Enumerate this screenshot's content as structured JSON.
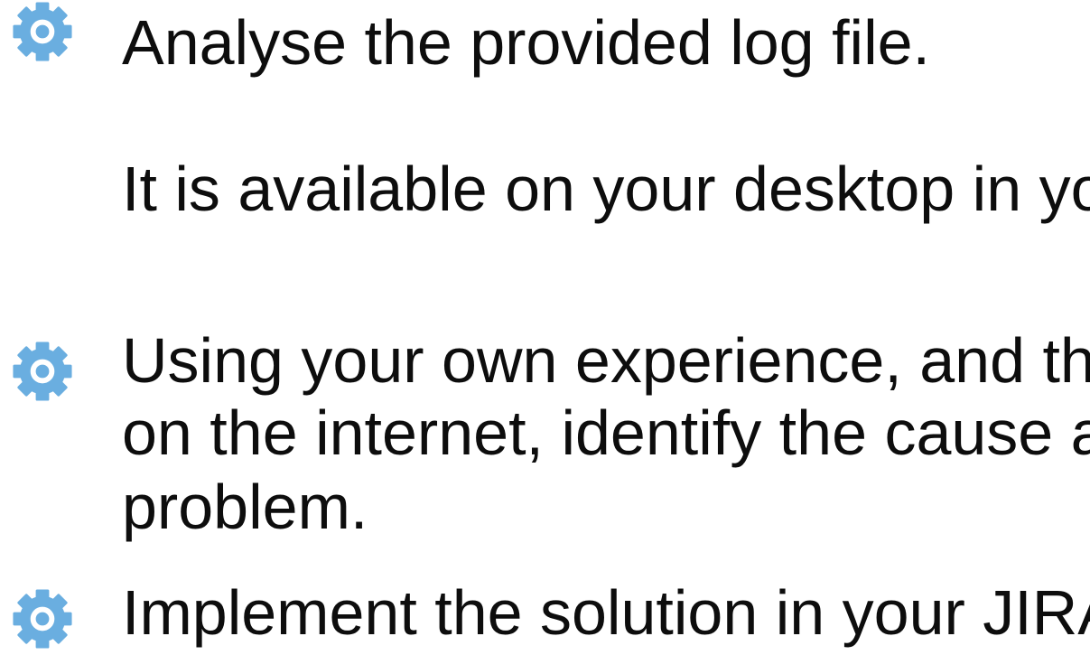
{
  "slide": {
    "bullets": [
      {
        "icon": "gear-icon",
        "lines": [
          "Analyse the provided log file."
        ]
      },
      {
        "icon": "none",
        "lines": [
          "It is available on your desktop in you"
        ]
      },
      {
        "icon": "gear-icon",
        "lines": [
          "Using your own experience, and the",
          "on the internet, identify the cause an",
          "problem."
        ]
      },
      {
        "icon": "gear-icon",
        "lines": [
          "Implement the solution in your JIRA."
        ]
      }
    ],
    "icon_color": "#6aaee0",
    "text_color": "#0d0d0d"
  }
}
